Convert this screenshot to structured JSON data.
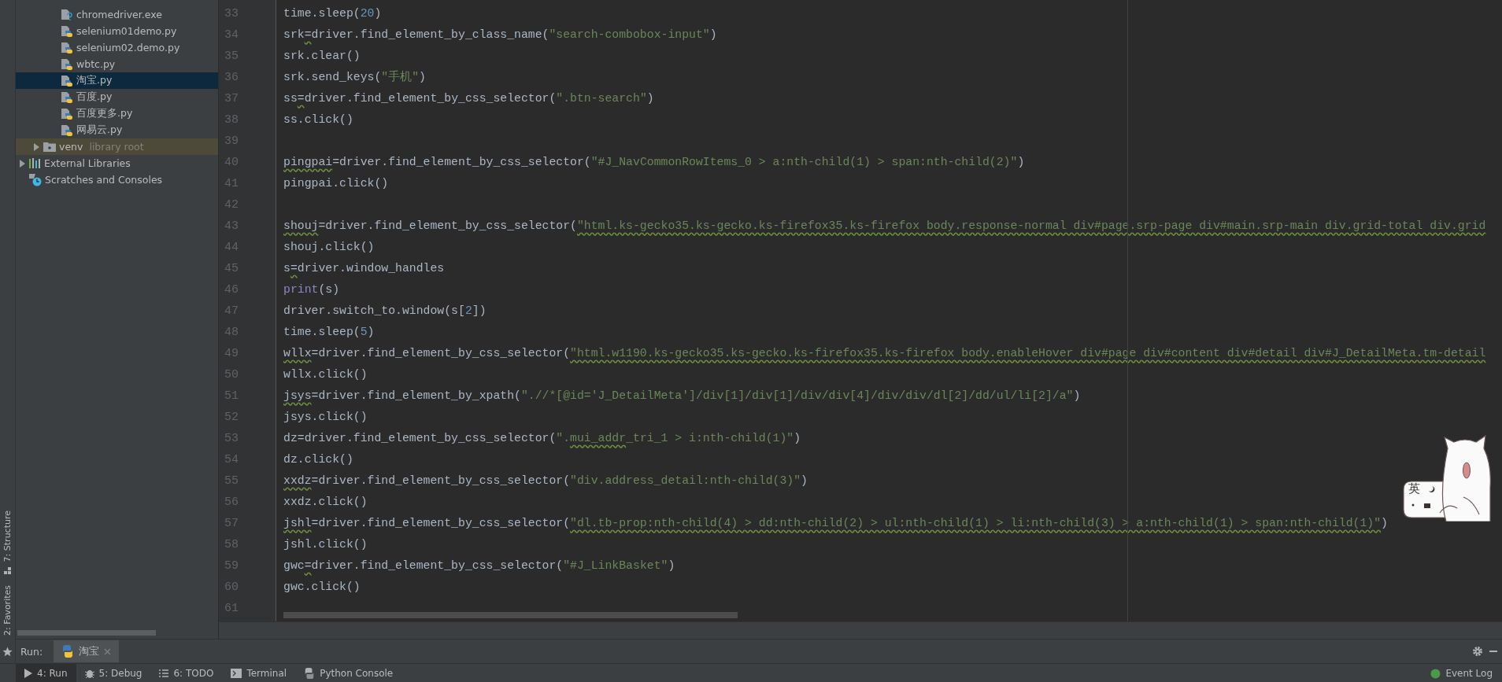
{
  "tool_stripe": [
    {
      "label": "7: Structure",
      "kind": "structure"
    },
    {
      "label": "2: Favorites",
      "kind": "favorites"
    }
  ],
  "project_tree": {
    "files": [
      {
        "name": "chromedriver.exe",
        "kind": "exe",
        "selected": false
      },
      {
        "name": "selenium01demo.py",
        "kind": "python",
        "selected": false
      },
      {
        "name": "selenium02.demo.py",
        "kind": "python",
        "selected": false
      },
      {
        "name": "wbtc.py",
        "kind": "python",
        "selected": false
      },
      {
        "name": "淘宝.py",
        "kind": "python",
        "selected": true
      },
      {
        "name": "百度.py",
        "kind": "python",
        "selected": false
      },
      {
        "name": "百度更多.py",
        "kind": "python",
        "selected": false
      },
      {
        "name": "网易云.py",
        "kind": "python",
        "selected": false
      }
    ],
    "folders": [
      {
        "name": "venv",
        "note": "library root",
        "expanded": false,
        "highlighted": true
      }
    ],
    "roots": [
      {
        "name": "External Libraries",
        "kind": "libraries",
        "expanded": false
      },
      {
        "name": "Scratches and Consoles",
        "kind": "scratches"
      }
    ]
  },
  "editor": {
    "lines": [
      {
        "number": "33",
        "tokens": [
          {
            "text": "time.sleep(",
            "kind": "plain"
          },
          {
            "text": "20",
            "kind": "number"
          },
          {
            "text": ")",
            "kind": "plain"
          }
        ]
      },
      {
        "number": "34",
        "tokens": [
          {
            "text": "srk",
            "kind": "plain"
          },
          {
            "text": "=",
            "kind": "typo"
          },
          {
            "text": "driver.find_element_by_class_name(",
            "kind": "plain"
          },
          {
            "text": "\"search-combobox-input\"",
            "kind": "string"
          },
          {
            "text": ")",
            "kind": "plain"
          }
        ]
      },
      {
        "number": "35",
        "tokens": [
          {
            "text": "srk.clear()",
            "kind": "plain"
          }
        ]
      },
      {
        "number": "36",
        "tokens": [
          {
            "text": "srk.send_keys(",
            "kind": "plain"
          },
          {
            "text": "\"手机\"",
            "kind": "string"
          },
          {
            "text": ")",
            "kind": "plain"
          }
        ]
      },
      {
        "number": "37",
        "tokens": [
          {
            "text": "ss",
            "kind": "plain"
          },
          {
            "text": "=",
            "kind": "typo"
          },
          {
            "text": "driver.find_element_by_css_selector(",
            "kind": "plain"
          },
          {
            "text": "\".btn-search\"",
            "kind": "string"
          },
          {
            "text": ")",
            "kind": "plain"
          }
        ]
      },
      {
        "number": "38",
        "tokens": [
          {
            "text": "ss.click()",
            "kind": "plain"
          }
        ]
      },
      {
        "number": "39"
      },
      {
        "number": "40",
        "tokens": [
          {
            "text": "pingpai",
            "kind": "typo"
          },
          {
            "text": "=driver.find_element_by_css_selector(",
            "kind": "plain"
          },
          {
            "text": "\"#J_NavCommonRowItems_0 > a:nth-child(1) > span:nth-child(2)\"",
            "kind": "string"
          },
          {
            "text": ")",
            "kind": "plain"
          }
        ]
      },
      {
        "number": "41",
        "tokens": [
          {
            "text": "pingpai.click()",
            "kind": "plain"
          }
        ]
      },
      {
        "number": "42"
      },
      {
        "number": "43",
        "tokens": [
          {
            "text": "shouj",
            "kind": "typo"
          },
          {
            "text": "=driver.find_element_by_css_selector(",
            "kind": "plain"
          },
          {
            "text": "\"html.ks-gecko35.ks-gecko.ks-firefox35.ks-firefox body.response-normal div#page.srp-page div#main.srp-main div.grid-total div.grid",
            "kind": "string_typo"
          }
        ]
      },
      {
        "number": "44",
        "tokens": [
          {
            "text": "shouj.click()",
            "kind": "plain"
          }
        ]
      },
      {
        "number": "45",
        "tokens": [
          {
            "text": "s",
            "kind": "plain"
          },
          {
            "text": "=",
            "kind": "typo"
          },
          {
            "text": "driver.window_handles",
            "kind": "plain"
          }
        ]
      },
      {
        "number": "46",
        "tokens": [
          {
            "text": "print",
            "kind": "builtin"
          },
          {
            "text": "(s)",
            "kind": "plain"
          }
        ]
      },
      {
        "number": "47",
        "tokens": [
          {
            "text": "driver.switch_to.window(s[",
            "kind": "plain"
          },
          {
            "text": "2",
            "kind": "number"
          },
          {
            "text": "])",
            "kind": "plain"
          }
        ]
      },
      {
        "number": "48",
        "tokens": [
          {
            "text": "time.sleep(",
            "kind": "plain"
          },
          {
            "text": "5",
            "kind": "number"
          },
          {
            "text": ")",
            "kind": "plain"
          }
        ]
      },
      {
        "number": "49",
        "tokens": [
          {
            "text": "wllx",
            "kind": "typo"
          },
          {
            "text": "=driver.find_element_by_css_selector(",
            "kind": "plain"
          },
          {
            "text": "\"html.w1190.ks-gecko35.ks-gecko.ks-firefox35.ks-firefox body.enableHover div#page div#content div#detail div#J_DetailMeta.tm-detail",
            "kind": "string_typo"
          }
        ]
      },
      {
        "number": "50",
        "tokens": [
          {
            "text": "wllx.click()",
            "kind": "plain"
          }
        ]
      },
      {
        "number": "51",
        "tokens": [
          {
            "text": "jsys",
            "kind": "typo"
          },
          {
            "text": "=driver.find_element_by_xpath(",
            "kind": "plain"
          },
          {
            "text": "\".//*[@id='J_DetailMeta']/div[1]/div[1]/div/div[4]/div/div/dl[2]/dd/ul/li[2]/a\"",
            "kind": "string"
          },
          {
            "text": ")",
            "kind": "plain"
          }
        ]
      },
      {
        "number": "52",
        "tokens": [
          {
            "text": "jsys.click()",
            "kind": "plain"
          }
        ]
      },
      {
        "number": "53",
        "tokens": [
          {
            "text": "dz=driver.find_element_by_css_selector(",
            "kind": "plain"
          },
          {
            "text": "\".",
            "kind": "string"
          },
          {
            "text": "mui_addr",
            "kind": "string_typo"
          },
          {
            "text": "_tri_1 > i:nth-child(1)\"",
            "kind": "string"
          },
          {
            "text": ")",
            "kind": "plain"
          }
        ]
      },
      {
        "number": "54",
        "tokens": [
          {
            "text": "dz.click()",
            "kind": "plain"
          }
        ]
      },
      {
        "number": "55",
        "tokens": [
          {
            "text": "xxdz",
            "kind": "typo"
          },
          {
            "text": "=driver.find_element_by_css_selector(",
            "kind": "plain"
          },
          {
            "text": "\"div.address_detail:nth-child(3)\"",
            "kind": "string"
          },
          {
            "text": ")",
            "kind": "plain"
          }
        ]
      },
      {
        "number": "56",
        "tokens": [
          {
            "text": "xxdz.click()",
            "kind": "plain"
          }
        ]
      },
      {
        "number": "57",
        "tokens": [
          {
            "text": "jshl",
            "kind": "typo"
          },
          {
            "text": "=driver.find_element_by_css_selector(",
            "kind": "plain"
          },
          {
            "text": "\"dl.tb-prop:nth-child(4) > dd:nth-child(2) > ul:nth-child(1) > li:nth-child(3) > a:nth-child(1) > span:nth-child(1)\"",
            "kind": "string_typo"
          },
          {
            "text": ")",
            "kind": "plain"
          }
        ]
      },
      {
        "number": "58",
        "tokens": [
          {
            "text": "jshl.click()",
            "kind": "plain"
          }
        ]
      },
      {
        "number": "59",
        "tokens": [
          {
            "text": "gwc",
            "kind": "plain"
          },
          {
            "text": "=",
            "kind": "typo"
          },
          {
            "text": "driver.find_element_by_css_selector(",
            "kind": "plain"
          },
          {
            "text": "\"#J_LinkBasket\"",
            "kind": "string"
          },
          {
            "text": ")",
            "kind": "plain"
          }
        ]
      },
      {
        "number": "60",
        "tokens": [
          {
            "text": "gwc.click()",
            "kind": "plain"
          }
        ]
      },
      {
        "number": "61"
      }
    ]
  },
  "ime_widget": {
    "mode": "英"
  },
  "run_bar": {
    "label": "Run:",
    "tabs": [
      {
        "label": "淘宝",
        "selected": true
      }
    ]
  },
  "bottom_tabs": [
    {
      "label": "4: Run",
      "kind": "run",
      "selected": true
    },
    {
      "label": "5: Debug",
      "kind": "debug",
      "selected": false
    },
    {
      "label": "6: TODO",
      "kind": "todo",
      "selected": false
    },
    {
      "label": "Terminal",
      "kind": "terminal",
      "selected": false
    },
    {
      "label": "Python Console",
      "kind": "python",
      "selected": false
    }
  ],
  "event_log": {
    "label": "Event Log"
  }
}
